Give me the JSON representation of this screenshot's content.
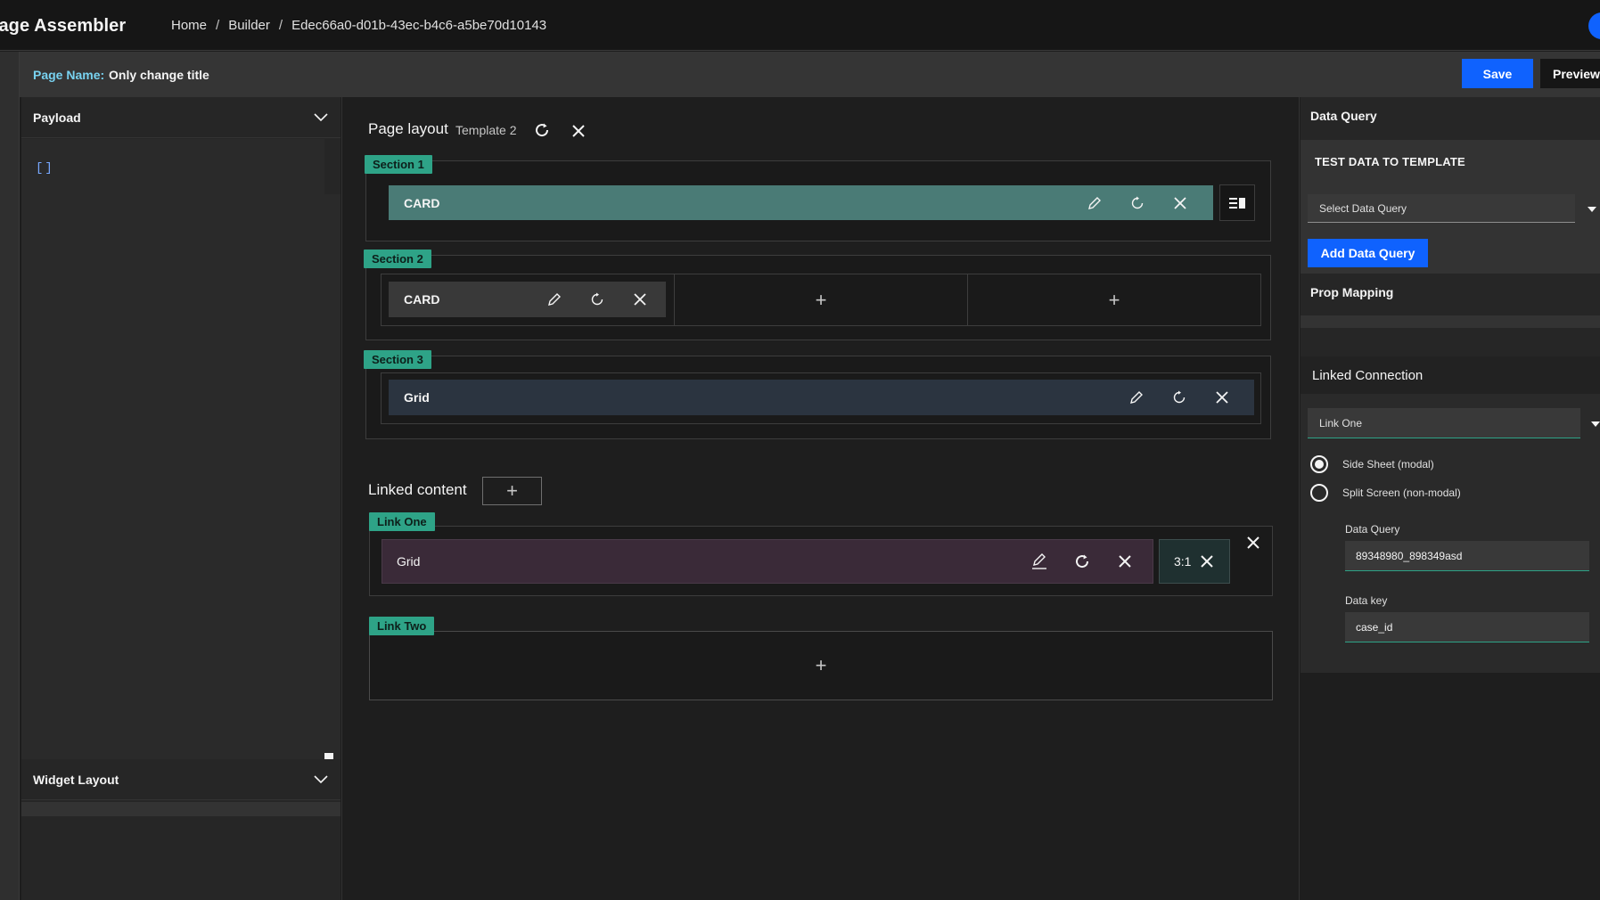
{
  "header": {
    "app_title": "Page Assembler",
    "breadcrumb": [
      "Home",
      "Builder",
      "Edec66a0-d01b-43ec-b4c6-a5be70d10143"
    ],
    "breadcrumb_separator": "/"
  },
  "page_name_bar": {
    "label": "Page Name:",
    "value": "Only change title",
    "save_label": "Save",
    "preview_label": "Preview"
  },
  "left_panel": {
    "payload_title": "Payload",
    "payload_value": "[]",
    "widget_layout_title": "Widget Layout"
  },
  "page_layout": {
    "title": "Page layout",
    "template": "Template 2",
    "sections": [
      {
        "tag": "Section 1",
        "slots": [
          {
            "label": "CARD"
          }
        ]
      },
      {
        "tag": "Section 2",
        "slots": [
          {
            "label": "CARD"
          },
          {
            "empty": "+"
          },
          {
            "empty": "+"
          }
        ]
      },
      {
        "tag": "Section 3",
        "slots": [
          {
            "label": "Grid"
          }
        ]
      }
    ]
  },
  "linked_content": {
    "title": "Linked content",
    "add_symbol": "+",
    "links": [
      {
        "tag": "Link One",
        "label": "Grid",
        "ratio": "3:1"
      },
      {
        "tag": "Link Two",
        "empty": "+"
      }
    ]
  },
  "right_panel": {
    "data_query_title": "Data Query",
    "test_data_label": "TEST DATA TO TEMPLATE",
    "select_placeholder": "Select Data Query",
    "add_data_query_label": "Add Data Query",
    "prop_mapping_title": "Prop Mapping",
    "linked_connection_title": "Linked Connection",
    "link_select_value": "Link One",
    "radio_options": [
      {
        "label": "Side Sheet (modal)",
        "selected": true
      },
      {
        "label": "Split Screen (non-modal)",
        "selected": false
      }
    ],
    "data_query_label": "Data Query",
    "data_query_value": "89348980_898349asd",
    "data_key_label": "Data key",
    "data_key_value": "case_id"
  },
  "colors": {
    "accent_blue": "#0f62fe",
    "section_tag": "#2ea387",
    "card1_bg": "#4a7b76",
    "link_grid_bg": "#3a2a38"
  }
}
